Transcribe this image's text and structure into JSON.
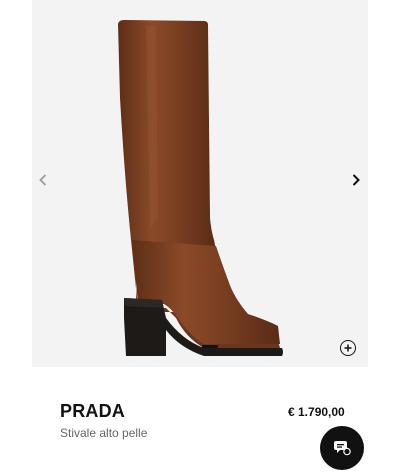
{
  "product": {
    "brand": "PRADA",
    "name": "Stivale alto pelle",
    "price": "€ 1.790,00"
  },
  "gallery": {
    "image_icon": "boot-image",
    "prev_icon": "chevron-left-icon",
    "next_icon": "chevron-right-icon",
    "zoom_icon": "zoom-plus-icon",
    "slides_shown": 1
  },
  "chat": {
    "icon": "chat-icon"
  },
  "colors": {
    "boot_leather": "#7a3f22",
    "boot_heel": "#1e1a17",
    "gallery_bg": "#f3f3f3",
    "chat_bg": "#111111"
  }
}
